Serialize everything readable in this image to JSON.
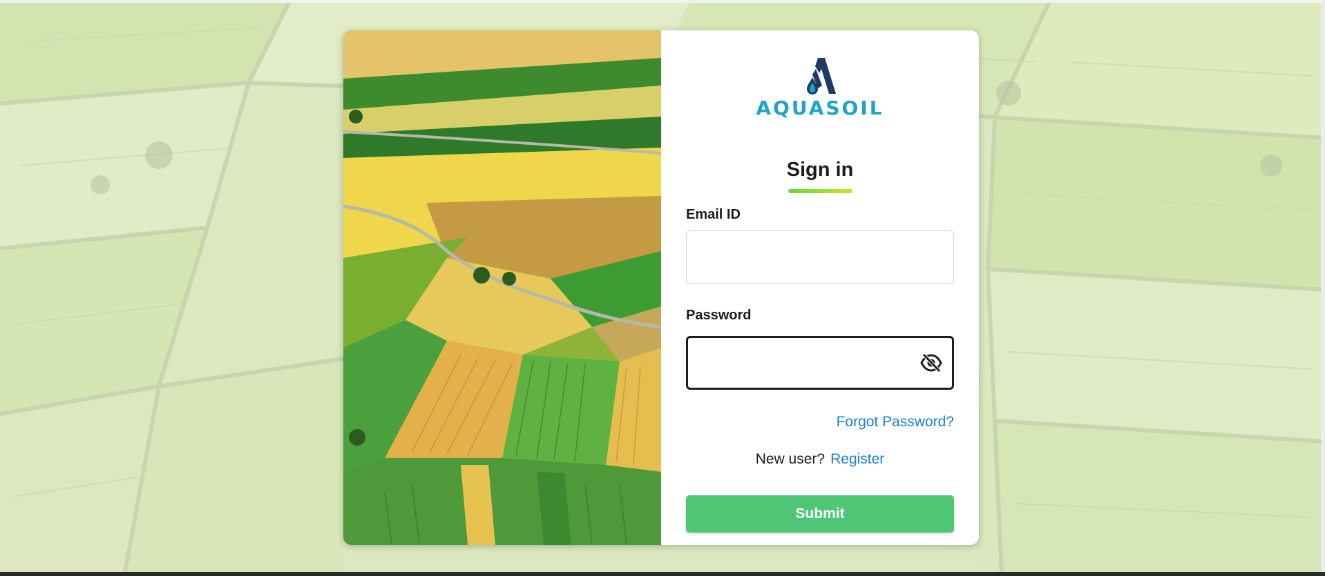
{
  "brand": {
    "name": "AQUASOIL",
    "primary_color": "#1da5c8",
    "mark_color": "#1c3c66"
  },
  "login": {
    "title": "Sign in",
    "email_label": "Email ID",
    "email_value": "",
    "password_label": "Password",
    "password_value": "",
    "forgot_password": "Forgot Password?",
    "new_user_text": "New user?",
    "register_link": "Register",
    "submit_label": "Submit"
  },
  "colors": {
    "link": "#1a7fd8",
    "submit": "#4fc576",
    "title_underline_start": "#6ad63a",
    "title_underline_end": "#c7e52a"
  },
  "icons": {
    "password_toggle": "eye-slash-icon"
  }
}
